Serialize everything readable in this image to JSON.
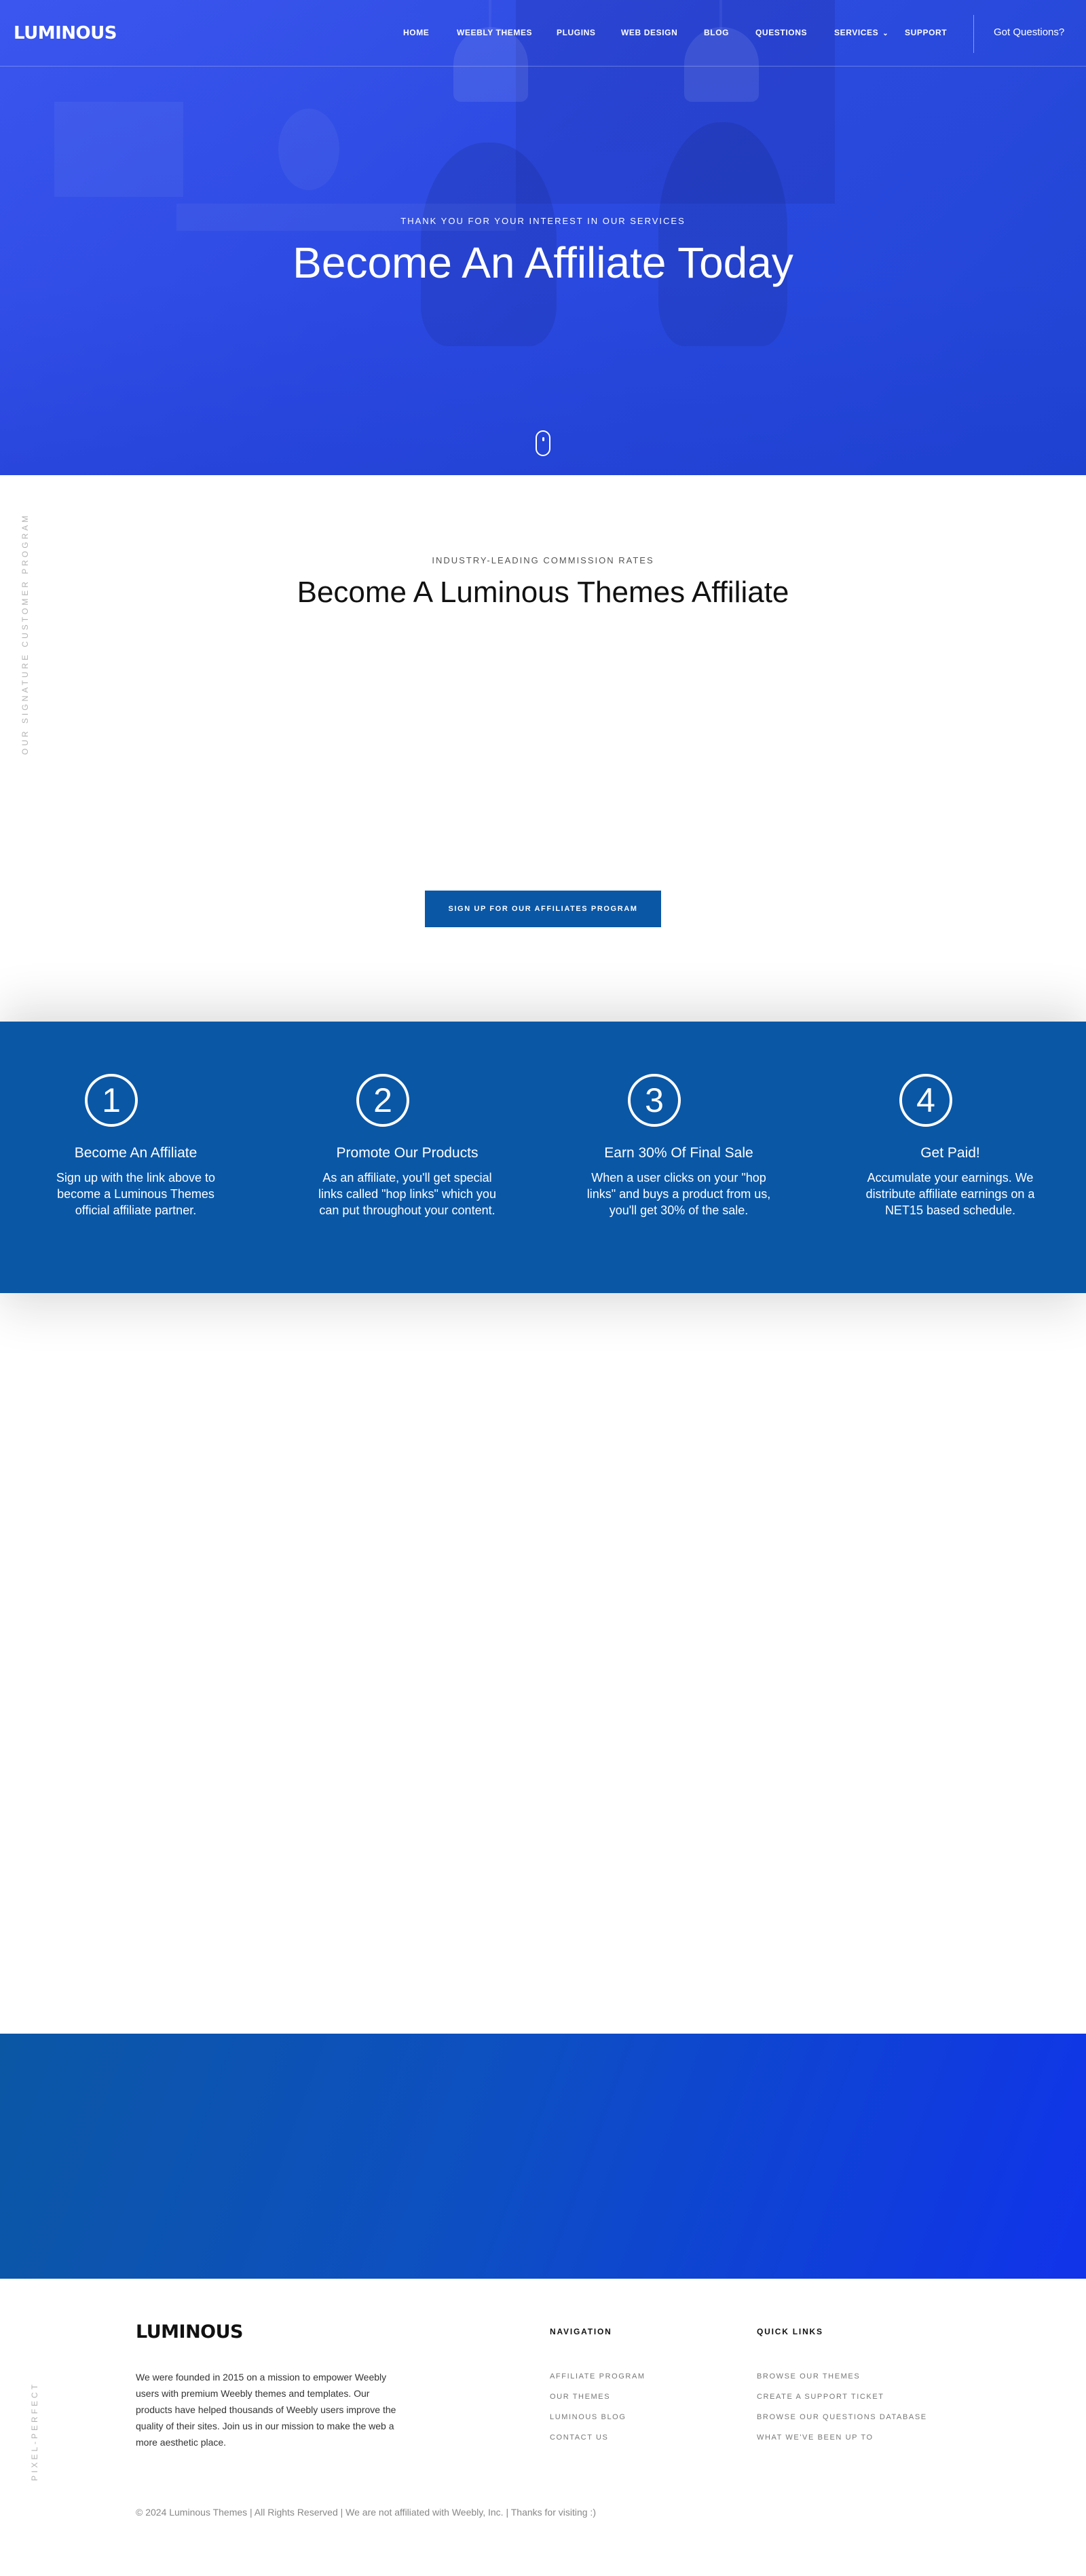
{
  "header": {
    "logo": "LUMINOUS",
    "nav": [
      "HOME",
      "WEEBLY THEMES",
      "PLUGINS",
      "WEB DESIGN",
      "BLOG",
      "QUESTIONS",
      "SERVICES",
      "SUPPORT"
    ],
    "got_questions": "Got Questions?"
  },
  "hero": {
    "kicker": "THANK YOU FOR YOUR INTEREST IN OUR SERVICES",
    "title": "Become An Affiliate Today"
  },
  "intro": {
    "side_text": "OUR SIGNATURE CUSTOMER PROGRAM",
    "kicker": "INDUSTRY-LEADING COMMISSION RATES",
    "title": "Become A Luminous Themes Affiliate",
    "cta": "SIGN UP FOR OUR AFFILIATES PROGRAM"
  },
  "steps": [
    {
      "number": "1",
      "title": "Become An Affiliate",
      "text": "Sign up with the link above to become a Luminous Themes official affiliate partner."
    },
    {
      "number": "2",
      "title": "Promote Our Products",
      "text": "As an affiliate, you'll get special links called \"hop links\" which you can put throughout your content."
    },
    {
      "number": "3",
      "title": "Earn 30% Of Final Sale",
      "text": "When a user clicks on your \"hop links\" and buys a product from us, you'll get 30% of the sale."
    },
    {
      "number": "4",
      "title": "Get Paid!",
      "text": "Accumulate your earnings. We distribute affiliate earnings on a NET15 based schedule."
    }
  ],
  "footer": {
    "side_text": "PIXEL-PERFECT",
    "logo": "LUMINOUS",
    "about": "We were founded in 2015 on a mission to empower Weebly users with premium Weebly themes and templates. Our products have helped thousands of Weebly users improve the quality of their sites. Join us in our mission to make the web a more aesthetic place.",
    "navigation": {
      "heading": "NAVIGATION",
      "links": [
        "AFFILIATE PROGRAM",
        "OUR THEMES",
        "LUMINOUS BLOG",
        "CONTACT US"
      ]
    },
    "quick_links": {
      "heading": "QUICK LINKS",
      "links": [
        "BROWSE OUR THEMES",
        "CREATE A SUPPORT TICKET",
        "BROWSE OUR QUESTIONS DATABASE",
        "WHAT WE'VE BEEN UP TO"
      ]
    },
    "copyright": "© 2024 Luminous Themes | All Rights Reserved | We are not affiliated with Weebly, Inc. | Thanks for visiting :)"
  }
}
